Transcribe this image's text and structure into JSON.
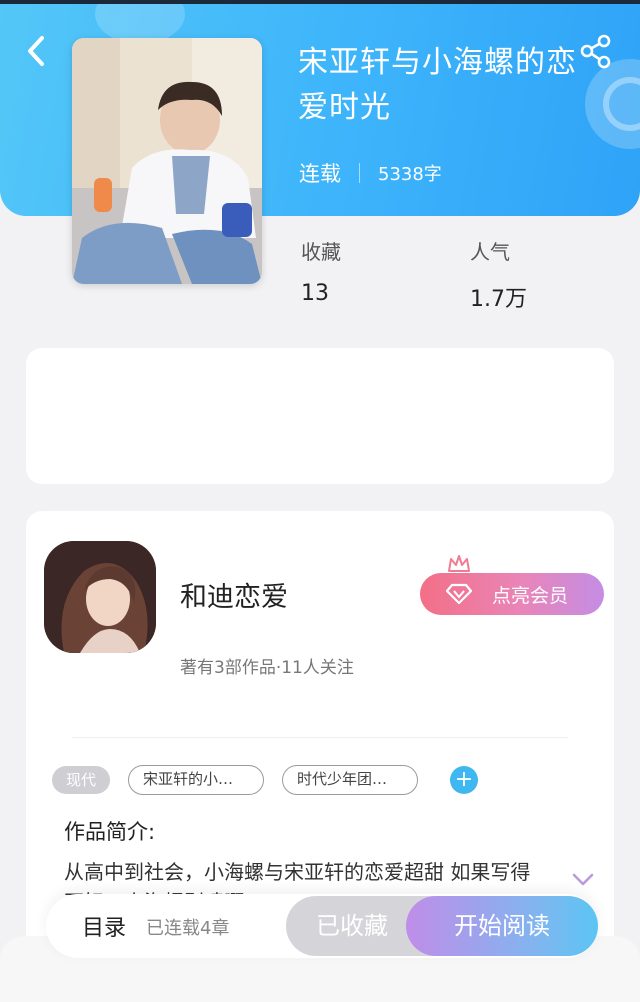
{
  "book": {
    "title": "宋亚轩与小海螺的恋爱时光",
    "status": "连载",
    "word_count": "5338字",
    "stats": {
      "favorites_label": "收藏",
      "favorites_value": "13",
      "popularity_label": "人气",
      "popularity_value": "1.7万"
    }
  },
  "author": {
    "name": "和迪恋爱",
    "meta": "著有3部作品·11人关注",
    "vip_button": "点亮会员"
  },
  "tags": {
    "category": "现代",
    "items": [
      "宋亚轩的小…",
      "时代少年团…"
    ]
  },
  "intro": {
    "title": "作品简介:",
    "text": "从高中到社会，小海螺与宋亚轩的恋爱超甜 如果写得不好，小海螺别喷啊"
  },
  "bottom": {
    "toc_label": "目录",
    "toc_sub": "已连载4章",
    "collected_button": "已收藏",
    "read_button": "开始阅读"
  },
  "colors": {
    "header_gradient_start": "#53c7f7",
    "header_gradient_end": "#2fa3f7",
    "accent": "#3fb8f2",
    "vip_pink": "#f36f86",
    "vip_purple": "#c48de4"
  },
  "icons": [
    "back-arrow-icon",
    "share-icon",
    "crown-icon",
    "diamond-icon",
    "plus-icon",
    "chevron-down-icon"
  ]
}
